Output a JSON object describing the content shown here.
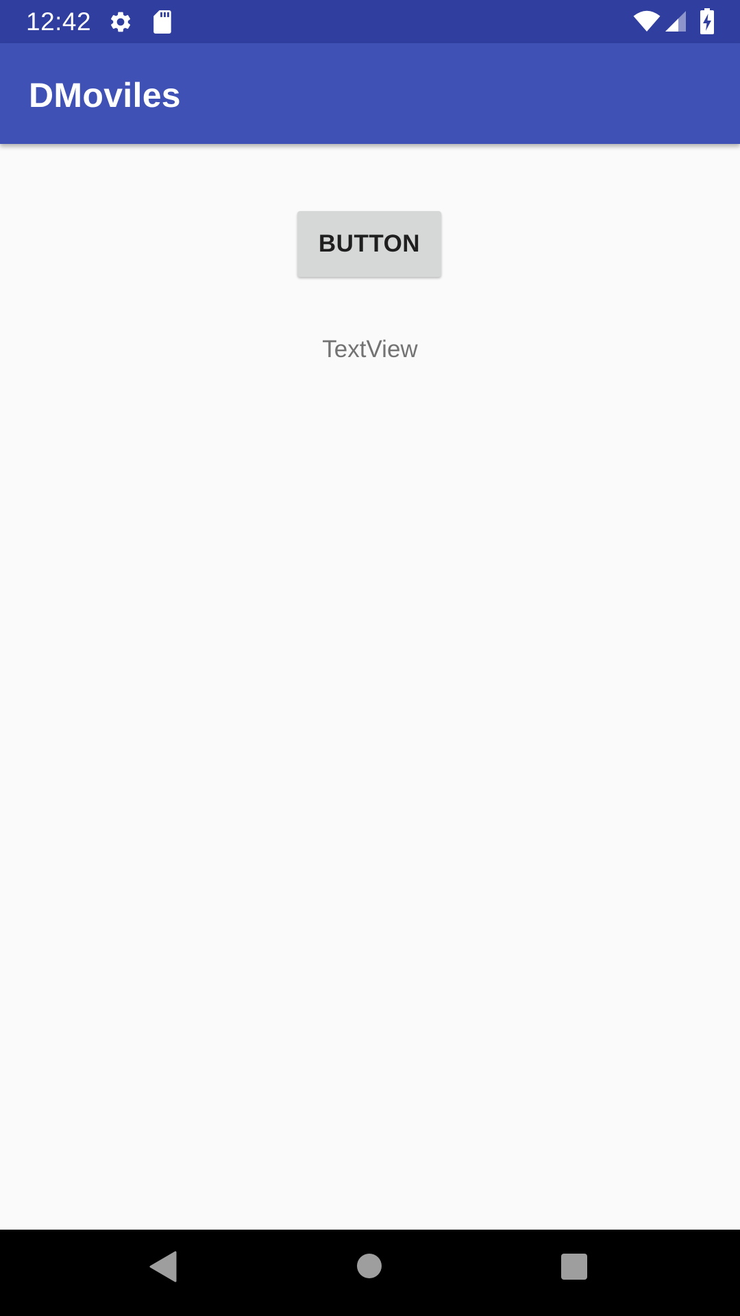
{
  "status_bar": {
    "time": "12:42",
    "icons": [
      "settings-icon",
      "sd-card-icon",
      "wifi-icon",
      "cell-signal-icon",
      "battery-charging-icon"
    ],
    "background": "#303f9f"
  },
  "app_bar": {
    "title": "DMoviles",
    "background": "#3f51b5"
  },
  "main": {
    "button_label": "BUTTON",
    "text_view": "TextView"
  },
  "nav_bar": {
    "keys": [
      "back-icon",
      "home-icon",
      "recents-icon"
    ],
    "background": "#000000"
  }
}
